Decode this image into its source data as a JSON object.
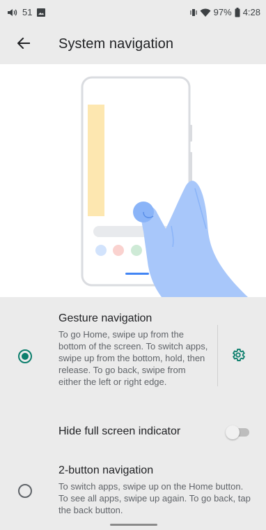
{
  "status_bar": {
    "volume_icon": "volume-icon",
    "notification_count": "51",
    "image_icon": "image-icon",
    "vibrate_icon": "vibrate-icon",
    "wifi_icon": "wifi-icon",
    "battery_percent": "97%",
    "battery_icon": "battery-icon",
    "time": "4:28"
  },
  "app_bar": {
    "back_icon": "arrow-back-icon",
    "title": "System navigation"
  },
  "illustration": {
    "description_icon": "gesture-navigation-illustration"
  },
  "options": {
    "gesture": {
      "title": "Gesture navigation",
      "description": "To go Home, swipe up from the bottom of the screen. To switch apps, swipe up from the bottom, hold, then release. To go back, swipe from either the left or right edge.",
      "selected": true,
      "settings_icon": "gear-icon"
    },
    "hide_indicator": {
      "label": "Hide full screen indicator",
      "enabled": false
    },
    "two_button": {
      "title": "2-button navigation",
      "description": "To switch apps, swipe up on the Home button. To see all apps, swipe up again. To go back, tap the back button.",
      "selected": false
    }
  },
  "colors": {
    "accent": "#0d7f6d",
    "surface": "#ebebeb",
    "illustration_blue": "#a8c7fa"
  }
}
